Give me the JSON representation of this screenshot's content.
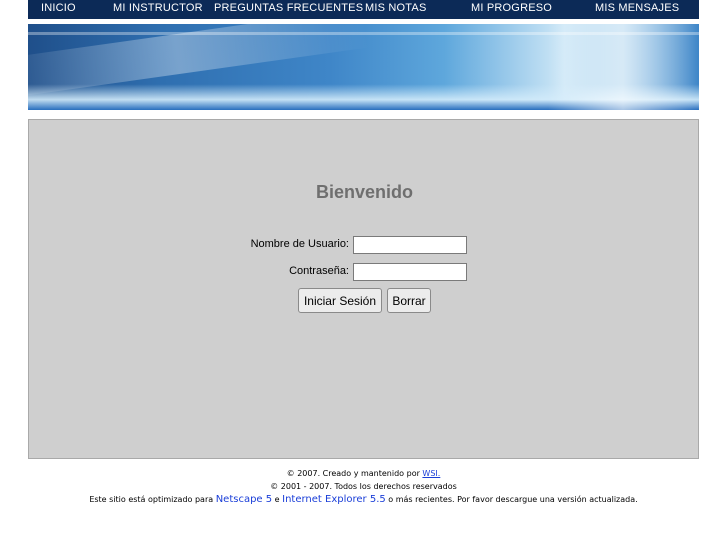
{
  "nav": {
    "items": [
      "INICIO",
      "MI INSTRUCTOR",
      "PREGUNTAS FRECUENTES",
      "MIS NOTAS",
      "MI PROGRESO",
      "MIS MENSAJES"
    ]
  },
  "login": {
    "title": "Bienvenido",
    "username_label": "Nombre de Usuario:",
    "username_value": "",
    "password_label": "Contraseña:",
    "password_value": "",
    "submit_label": "Iniciar Sesión",
    "reset_label": "Borrar"
  },
  "footer": {
    "line1_prefix": "© 2007. Creado y mantenido por ",
    "line1_link": "WSI.",
    "line2": "© 2001 - 2007. Todos los derechos reservados",
    "line3_prefix": "Este sitio está optimizado para ",
    "netscape": "Netscape 5",
    "conj": " e ",
    "ie": "Internet Explorer 5.5",
    "line3_suffix": " o más recientes. Por favor descargue una versión actualizada."
  },
  "colors": {
    "nav_bg": "#0c2a57",
    "panel_bg": "#cfcfcf",
    "link": "#1a3ed8"
  }
}
